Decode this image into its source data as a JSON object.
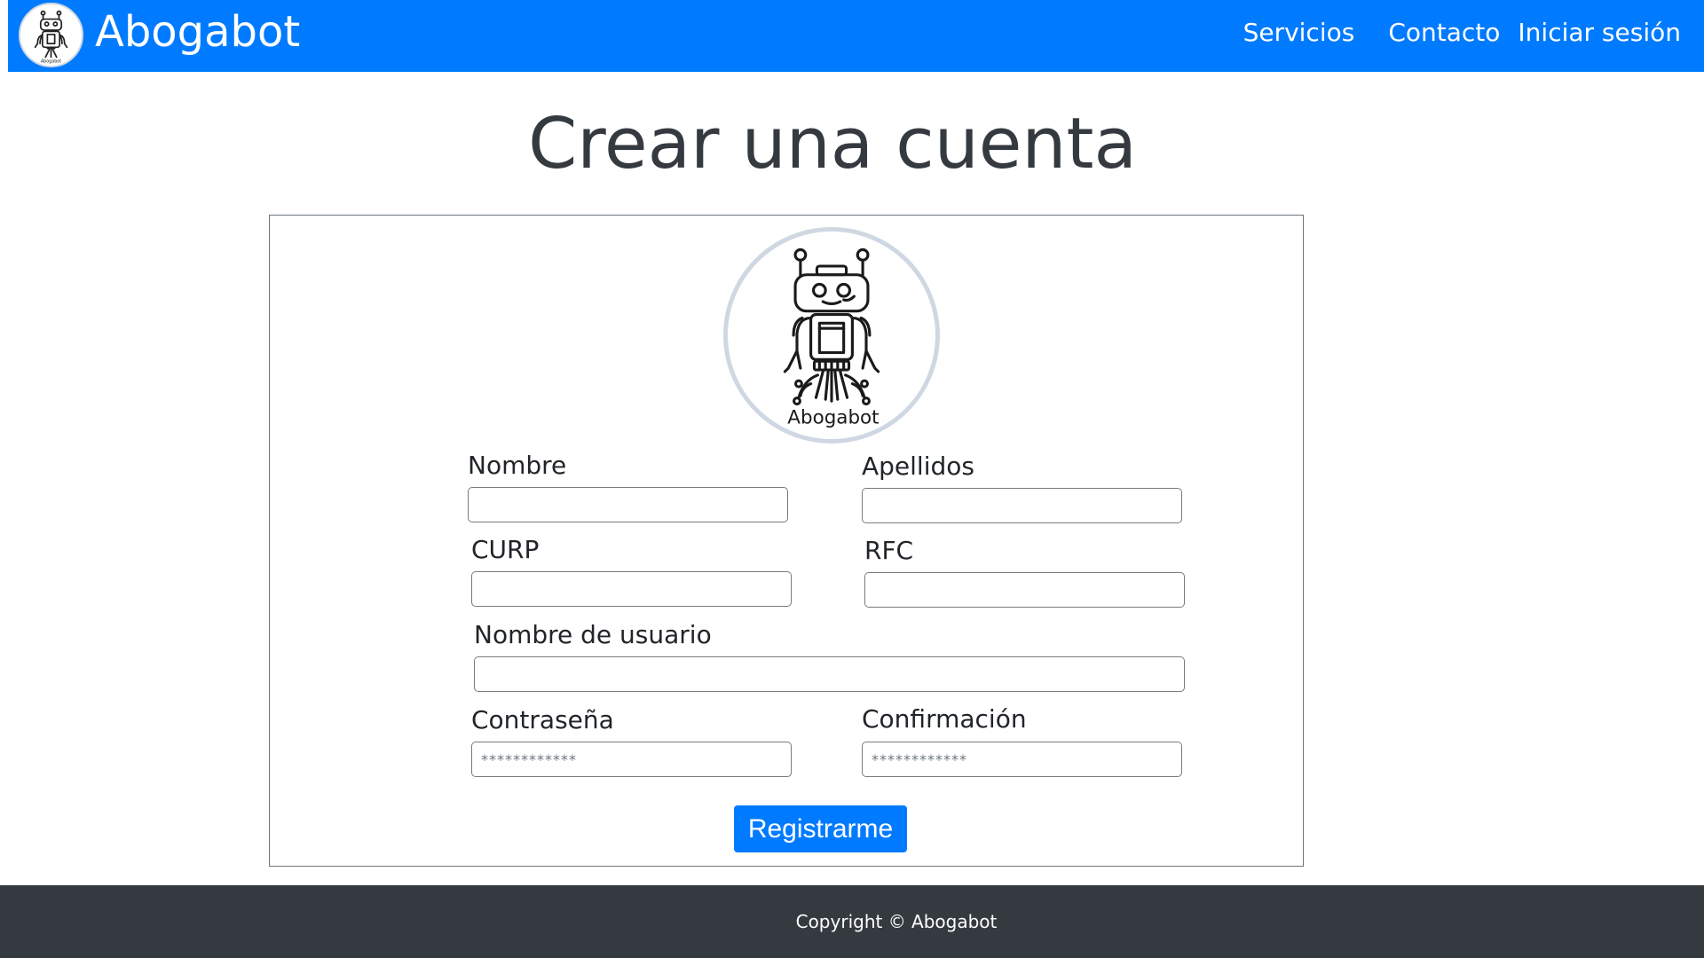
{
  "navbar": {
    "brand_name": "Abogabot",
    "logo_icon": "robot-logo-icon",
    "logo_text": "Abogabot",
    "accent_color": "#007bff",
    "links": [
      "Servicios",
      "Contacto",
      "Iniciar sesión"
    ]
  },
  "page": {
    "title": "Crear una cuenta"
  },
  "form": {
    "logo_text": "Abogabot",
    "fields": {
      "nombre": {
        "label": "Nombre",
        "value": ""
      },
      "apellidos": {
        "label": "Apellidos",
        "value": ""
      },
      "curp": {
        "label": "CURP",
        "value": ""
      },
      "rfc": {
        "label": "RFC",
        "value": ""
      },
      "usuario": {
        "label": "Nombre de usuario",
        "value": ""
      },
      "contrasena": {
        "label": "Contraseña",
        "placeholder": "************"
      },
      "confirmacion": {
        "label": "Confirmación",
        "placeholder": "************"
      }
    },
    "submit_label": "Registrarme"
  },
  "footer": {
    "text": "Copyright © Abogabot",
    "background_color": "#343a40"
  }
}
